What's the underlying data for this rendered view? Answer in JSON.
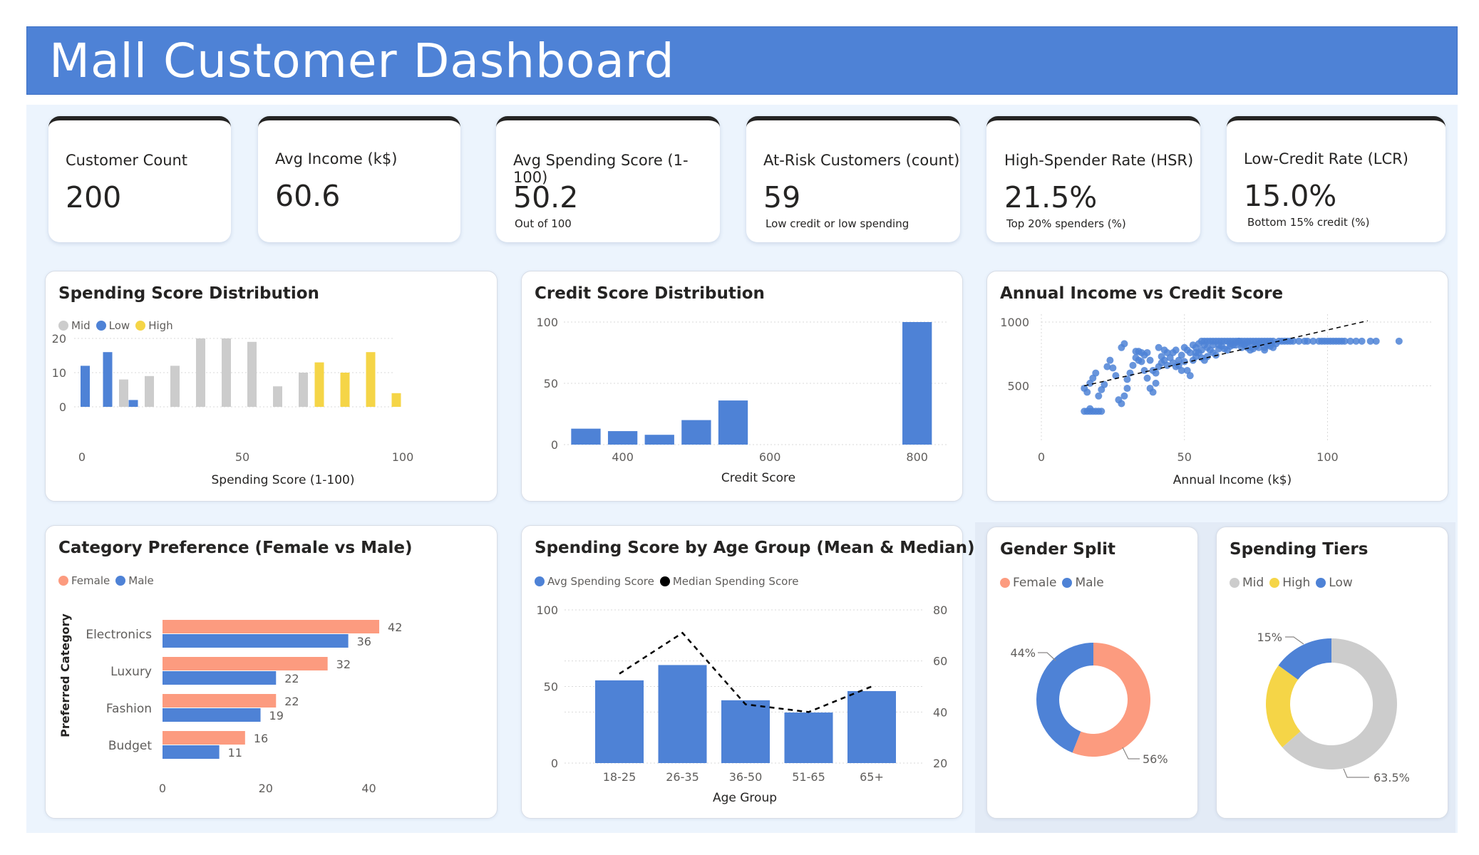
{
  "header": {
    "title": "Mall Customer Dashboard"
  },
  "kpis": [
    {
      "title": "Customer Count",
      "value": "200",
      "sub": ""
    },
    {
      "title": "Avg Income (k$)",
      "value": "60.6",
      "sub": ""
    },
    {
      "title": "Avg Spending Score (1-100)",
      "value": "50.2",
      "sub": "Out of 100"
    },
    {
      "title": "At-Risk Customers (count)",
      "value": "59",
      "sub": "Low credit or low spending"
    },
    {
      "title": "High-Spender Rate (HSR)",
      "value": "21.5%",
      "sub": "Top 20% spenders (%)"
    },
    {
      "title": "Low-Credit Rate (LCR)",
      "value": "15.0%",
      "sub": "Bottom 15% credit (%)"
    }
  ],
  "colors": {
    "blue": "#4e82d6",
    "gray": "#cccccc",
    "yellow": "#f5d547",
    "salmon": "#fc9b7f",
    "black": "#000000"
  },
  "chart_data": [
    {
      "id": "spending_dist",
      "type": "bar",
      "title": "Spending Score Distribution",
      "xlabel": "Spending Score (1-100)",
      "ylabel": "",
      "xlim": [
        0,
        100
      ],
      "ylim": [
        0,
        20
      ],
      "xticks": [
        "0",
        "50",
        "100"
      ],
      "yticks": [
        "0",
        "10",
        "20"
      ],
      "grid": true,
      "legend": [
        "Mid",
        "Low",
        "High"
      ],
      "legend_colors": [
        "#cccccc",
        "#4e82d6",
        "#f5d547"
      ],
      "bars": [
        {
          "x": 1,
          "value": 12,
          "tier": "Low"
        },
        {
          "x": 8,
          "value": 16,
          "tier": "Low"
        },
        {
          "x": 13,
          "value": 8,
          "tier": "Mid"
        },
        {
          "x": 16,
          "value": 2,
          "tier": "Low"
        },
        {
          "x": 21,
          "value": 9,
          "tier": "Mid"
        },
        {
          "x": 29,
          "value": 12,
          "tier": "Mid"
        },
        {
          "x": 37,
          "value": 20,
          "tier": "Mid"
        },
        {
          "x": 45,
          "value": 20,
          "tier": "Mid"
        },
        {
          "x": 53,
          "value": 19,
          "tier": "Mid"
        },
        {
          "x": 61,
          "value": 6,
          "tier": "Mid"
        },
        {
          "x": 69,
          "value": 10,
          "tier": "Mid"
        },
        {
          "x": 74,
          "value": 13,
          "tier": "High"
        },
        {
          "x": 82,
          "value": 10,
          "tier": "High"
        },
        {
          "x": 90,
          "value": 16,
          "tier": "High"
        },
        {
          "x": 98,
          "value": 4,
          "tier": "High"
        }
      ]
    },
    {
      "id": "credit_dist",
      "type": "bar",
      "title": "Credit Score Distribution",
      "xlabel": "Credit Score",
      "ylabel": "",
      "xlim": [
        320,
        840
      ],
      "ylim": [
        0,
        100
      ],
      "xticks": [
        "400",
        "600",
        "800"
      ],
      "yticks": [
        "0",
        "50",
        "100"
      ],
      "grid": true,
      "bars": [
        {
          "x": 350,
          "value": 13
        },
        {
          "x": 400,
          "value": 11
        },
        {
          "x": 450,
          "value": 8
        },
        {
          "x": 500,
          "value": 20
        },
        {
          "x": 550,
          "value": 36
        },
        {
          "x": 800,
          "value": 100
        }
      ]
    },
    {
      "id": "income_vs_credit",
      "type": "scatter",
      "title": "Annual Income vs Credit Score",
      "xlabel": "Annual Income (k$)",
      "ylabel": "",
      "xlim": [
        0,
        137
      ],
      "ylim": [
        240,
        1000
      ],
      "xticks": [
        "0",
        "50",
        "100"
      ],
      "yticks": [
        "500",
        "1000"
      ],
      "grid": true,
      "trendline": {
        "x1": 15,
        "y1": 500,
        "x2": 114,
        "y2": 1010,
        "style": "dashed"
      },
      "points": [
        [
          15,
          300
        ],
        [
          16,
          300
        ],
        [
          17,
          300
        ],
        [
          18,
          300
        ],
        [
          19,
          300
        ],
        [
          20,
          300
        ],
        [
          21,
          300
        ],
        [
          17,
          320
        ],
        [
          15,
          480
        ],
        [
          16,
          450
        ],
        [
          17,
          520
        ],
        [
          18,
          560
        ],
        [
          19,
          600
        ],
        [
          20,
          420
        ],
        [
          21,
          470
        ],
        [
          22,
          510
        ],
        [
          23,
          650
        ],
        [
          24,
          700
        ],
        [
          25,
          640
        ],
        [
          26,
          580
        ],
        [
          27,
          390
        ],
        [
          28,
          360
        ],
        [
          29,
          420
        ],
        [
          30,
          480
        ],
        [
          30,
          550
        ],
        [
          31,
          600
        ],
        [
          32,
          660
        ],
        [
          33,
          720
        ],
        [
          34,
          770
        ],
        [
          35,
          690
        ],
        [
          36,
          620
        ],
        [
          37,
          560
        ],
        [
          38,
          480
        ],
        [
          39,
          450
        ],
        [
          40,
          520
        ],
        [
          40,
          600
        ],
        [
          41,
          650
        ],
        [
          42,
          680
        ],
        [
          43,
          700
        ],
        [
          44,
          660
        ],
        [
          45,
          720
        ],
        [
          46,
          680
        ],
        [
          47,
          650
        ],
        [
          48,
          700
        ],
        [
          49,
          740
        ],
        [
          50,
          690
        ],
        [
          51,
          620
        ],
        [
          52,
          580
        ],
        [
          53,
          700
        ],
        [
          54,
          730
        ],
        [
          55,
          760
        ],
        [
          56,
          720
        ],
        [
          57,
          700
        ],
        [
          58,
          730
        ],
        [
          59,
          780
        ],
        [
          60,
          760
        ],
        [
          61,
          740
        ],
        [
          62,
          790
        ],
        [
          63,
          810
        ],
        [
          64,
          790
        ],
        [
          65,
          780
        ],
        [
          66,
          810
        ],
        [
          67,
          820
        ],
        [
          68,
          840
        ],
        [
          69,
          850
        ],
        [
          70,
          850
        ],
        [
          71,
          820
        ],
        [
          72,
          800
        ],
        [
          73,
          780
        ],
        [
          74,
          790
        ],
        [
          75,
          810
        ],
        [
          76,
          830
        ],
        [
          77,
          850
        ],
        [
          78,
          800
        ],
        [
          79,
          820
        ],
        [
          80,
          850
        ],
        [
          81,
          850
        ],
        [
          83,
          850
        ],
        [
          85,
          850
        ],
        [
          87,
          850
        ],
        [
          90,
          850
        ],
        [
          93,
          850
        ],
        [
          97,
          850
        ],
        [
          99,
          850
        ],
        [
          101,
          850
        ],
        [
          103,
          850
        ],
        [
          108,
          850
        ],
        [
          112,
          850
        ],
        [
          117,
          850
        ],
        [
          125,
          850
        ],
        [
          54,
          760
        ],
        [
          55,
          830
        ],
        [
          56,
          850
        ],
        [
          57,
          850
        ],
        [
          58,
          850
        ],
        [
          59,
          850
        ],
        [
          60,
          850
        ],
        [
          61,
          850
        ],
        [
          62,
          850
        ],
        [
          63,
          850
        ],
        [
          64,
          850
        ],
        [
          65,
          850
        ],
        [
          66,
          850
        ],
        [
          67,
          850
        ],
        [
          68,
          850
        ],
        [
          69,
          850
        ],
        [
          70,
          830
        ],
        [
          71,
          850
        ],
        [
          72,
          850
        ],
        [
          73,
          850
        ],
        [
          74,
          850
        ],
        [
          75,
          850
        ],
        [
          76,
          850
        ],
        [
          78,
          850
        ],
        [
          79,
          850
        ],
        [
          80,
          830
        ],
        [
          81,
          800
        ],
        [
          28,
          800
        ],
        [
          29,
          830
        ],
        [
          33,
          770
        ],
        [
          46,
          760
        ],
        [
          48,
          660
        ],
        [
          47,
          780
        ],
        [
          43,
          780
        ],
        [
          44,
          760
        ],
        [
          41,
          800
        ],
        [
          42,
          730
        ],
        [
          38,
          700
        ],
        [
          39,
          620
        ],
        [
          36,
          740
        ],
        [
          35,
          760
        ],
        [
          34,
          700
        ],
        [
          37,
          760
        ],
        [
          49,
          620
        ],
        [
          50,
          800
        ],
        [
          51,
          780
        ],
        [
          52,
          760
        ],
        [
          53,
          820
        ],
        [
          54,
          800
        ],
        [
          56,
          780
        ],
        [
          57,
          820
        ],
        [
          58,
          800
        ],
        [
          60,
          820
        ],
        [
          62,
          820
        ],
        [
          66,
          830
        ],
        [
          68,
          820
        ],
        [
          70,
          800
        ],
        [
          72,
          840
        ],
        [
          74,
          820
        ],
        [
          76,
          800
        ],
        [
          78,
          780
        ],
        [
          80,
          810
        ],
        [
          82,
          830
        ],
        [
          84,
          850
        ],
        [
          86,
          850
        ],
        [
          88,
          850
        ],
        [
          92,
          850
        ],
        [
          95,
          850
        ],
        [
          98,
          850
        ],
        [
          100,
          850
        ],
        [
          102,
          850
        ],
        [
          104,
          850
        ],
        [
          105,
          850
        ],
        [
          106,
          850
        ],
        [
          110,
          850
        ],
        [
          115,
          850
        ]
      ]
    },
    {
      "id": "category_pref",
      "type": "bar",
      "orientation": "horizontal",
      "title": "Category Preference (Female vs Male)",
      "xlabel": "",
      "ylabel": "Preferred Category",
      "xlim": [
        0,
        46
      ],
      "xticks": [
        "0",
        "20",
        "40"
      ],
      "categories": [
        "Electronics",
        "Luxury",
        "Fashion",
        "Budget"
      ],
      "series": [
        {
          "name": "Female",
          "color": "#fc9b7f",
          "values": [
            42,
            32,
            22,
            16
          ]
        },
        {
          "name": "Male",
          "color": "#4e82d6",
          "values": [
            36,
            22,
            19,
            11
          ]
        }
      ]
    },
    {
      "id": "spending_by_age",
      "type": "bar",
      "title": "Spending Score by Age Group (Mean & Median)",
      "xlabel": "Age Group",
      "ylabel": "",
      "ylim": [
        0,
        100
      ],
      "y2lim": [
        20,
        80
      ],
      "yticks": [
        "0",
        "50",
        "100"
      ],
      "y2ticks": [
        "20",
        "40",
        "60",
        "80"
      ],
      "categories": [
        "18-25",
        "26-35",
        "36-50",
        "51-65",
        "65+"
      ],
      "series": [
        {
          "name": "Avg Spending Score",
          "type": "bar",
          "color": "#4e82d6",
          "values": [
            54,
            64,
            41,
            33,
            47
          ]
        },
        {
          "name": "Median Spending Score",
          "type": "line",
          "axis": "secondary",
          "color": "#000000",
          "style": "dashed",
          "values": [
            55,
            71,
            43,
            40,
            50
          ]
        }
      ]
    },
    {
      "id": "gender_split",
      "type": "pie",
      "title": "Gender Split",
      "legend": [
        "Female",
        "Male"
      ],
      "slices": [
        {
          "name": "Female",
          "value": 56,
          "label": "56%",
          "color": "#fc9b7f"
        },
        {
          "name": "Male",
          "value": 44,
          "label": "44%",
          "color": "#4e82d6"
        }
      ]
    },
    {
      "id": "spending_tiers",
      "type": "pie",
      "title": "Spending Tiers",
      "legend": [
        "Mid",
        "High",
        "Low"
      ],
      "slices": [
        {
          "name": "Mid",
          "value": 63.5,
          "label": "63.5%",
          "color": "#cccccc"
        },
        {
          "name": "High",
          "value": 21.5,
          "label": "",
          "color": "#f5d547"
        },
        {
          "name": "Low",
          "value": 15,
          "label": "15%",
          "color": "#4e82d6"
        }
      ]
    }
  ]
}
